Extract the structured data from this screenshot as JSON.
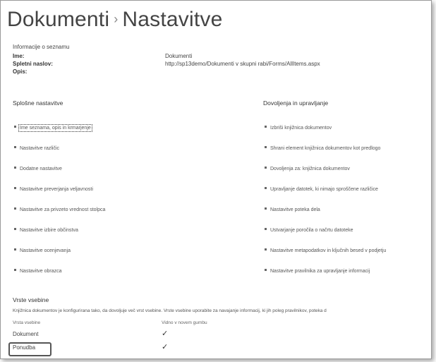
{
  "page": {
    "title_part1": "Dokumenti",
    "title_separator": "›",
    "title_part2": "Nastavitve"
  },
  "list_info": {
    "header": "Informacije o seznamu",
    "name_label": "Ime:",
    "name_value": "Dokumenti",
    "address_label": "Spletni naslov:",
    "address_value": "http://sp13demo/Dokumenti v skupni rabi/Forms/AllItems.aspx",
    "description_label": "Opis:"
  },
  "general_settings": {
    "title": "Splošne nastavitve",
    "items": [
      "Ime seznama, opis in krmarjenje",
      "Nastavitve različic",
      "Dodatne nastavitve",
      "Nastavitve preverjanja veljavnosti",
      "Nastavitve za privzeto vrednost stolpca",
      "Nastavitve izbire občinstva",
      "Nastavitve ocenjevanja",
      "Nastavitve obrazca"
    ]
  },
  "permissions": {
    "title": "Dovoljenja in upravljanje",
    "items": [
      "Izbriši knjižnica dokumentov",
      "Shrani element knjižnica dokumentov kot predlogo",
      "Dovoljenja za: knjižnica dokumentov",
      "Upravljanje datotek, ki nimajo sproščene različice",
      "Nastavitve poteka dela",
      "Ustvarjanje poročila o načrtu datoteke",
      "Nastavitve metapodatkov in ključnih besed v podjetju",
      "Nastavitve pravilnika za upravljanje informacij"
    ]
  },
  "content_types": {
    "title": "Vrste vsebine",
    "description": "Knjižnica dokumentov je konfigurirana tako, da dovoljuje več vrst vsebine. Vrste vsebine uporabite za navajanje informacij, ki jih poleg pravilnikov, poteka d",
    "col_type": "Vrsta vsebine",
    "col_visible": "Vidno v novem gumbu",
    "rows": [
      {
        "name": "Dokument",
        "check": "✓"
      },
      {
        "name": "Ponudba",
        "check": "✓"
      }
    ]
  }
}
